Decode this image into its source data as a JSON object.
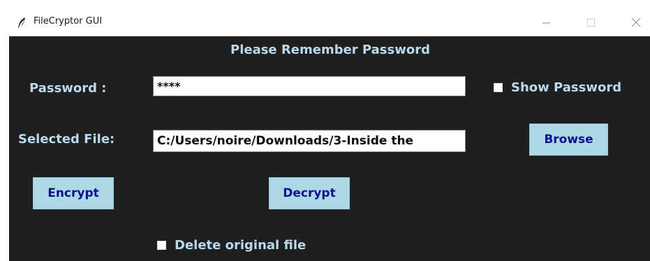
{
  "window": {
    "title": "FileCryptor GUI",
    "icon": "feather-icon",
    "controls": [
      "minimize-icon",
      "maximize-icon",
      "close-icon"
    ]
  },
  "heading": "Please Remember Password",
  "password": {
    "label": "Password :",
    "value": "****",
    "show_password_label": "Show Password",
    "show_password_checked": false
  },
  "file": {
    "label": "Selected File:",
    "value": "C:/Users/noire/Downloads/3-Inside the",
    "browse_label": "Browse"
  },
  "actions": {
    "encrypt_label": "Encrypt",
    "decrypt_label": "Decrypt"
  },
  "delete_original": {
    "label": "Delete original file",
    "checked": false
  },
  "colors": {
    "background": "#1f1f1f",
    "label_text": "#b9d9ee",
    "button_bg": "#add8e6",
    "button_text": "#10108a"
  }
}
